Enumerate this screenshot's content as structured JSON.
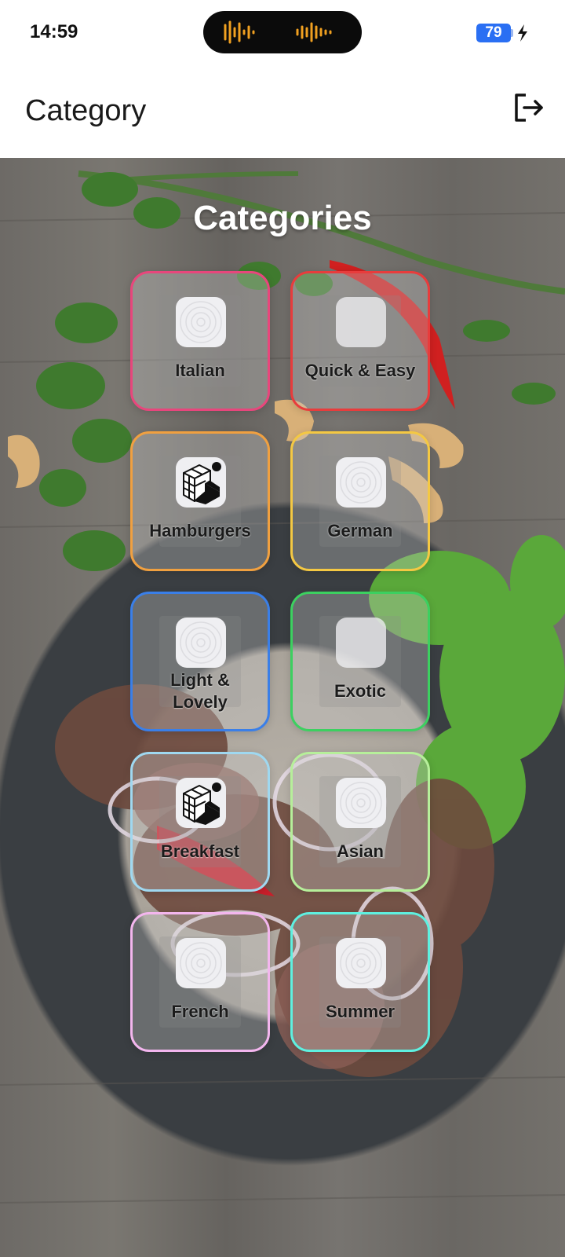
{
  "status_bar": {
    "time": "14:59",
    "battery": "79"
  },
  "header": {
    "title": "Category",
    "logout_icon": "logout-icon"
  },
  "main": {
    "title": "Categories",
    "categories": [
      {
        "label": "Italian",
        "border_color": "#e8467c",
        "icon": "placeholder-ring-icon"
      },
      {
        "label": "Quick & Easy",
        "border_color": "#e83c3c",
        "icon": "placeholder-blank-icon"
      },
      {
        "label": "Hamburgers",
        "border_color": "#f0a040",
        "icon": "cube-logo-icon"
      },
      {
        "label": "German",
        "border_color": "#f4c843",
        "icon": "placeholder-ring-icon"
      },
      {
        "label": "Light & Lovely",
        "border_color": "#3a7fe8",
        "icon": "placeholder-ring-icon"
      },
      {
        "label": "Exotic",
        "border_color": "#3cd060",
        "icon": "placeholder-blank-icon"
      },
      {
        "label": "Breakfast",
        "border_color": "#9fd8f0",
        "icon": "cube-logo-icon"
      },
      {
        "label": "Asian",
        "border_color": "#b6ef9a",
        "icon": "placeholder-ring-icon"
      },
      {
        "label": "French",
        "border_color": "#f3b6ee",
        "icon": "placeholder-ring-icon"
      },
      {
        "label": "Summer",
        "border_color": "#5ef0e0",
        "icon": "placeholder-ring-icon"
      }
    ]
  }
}
